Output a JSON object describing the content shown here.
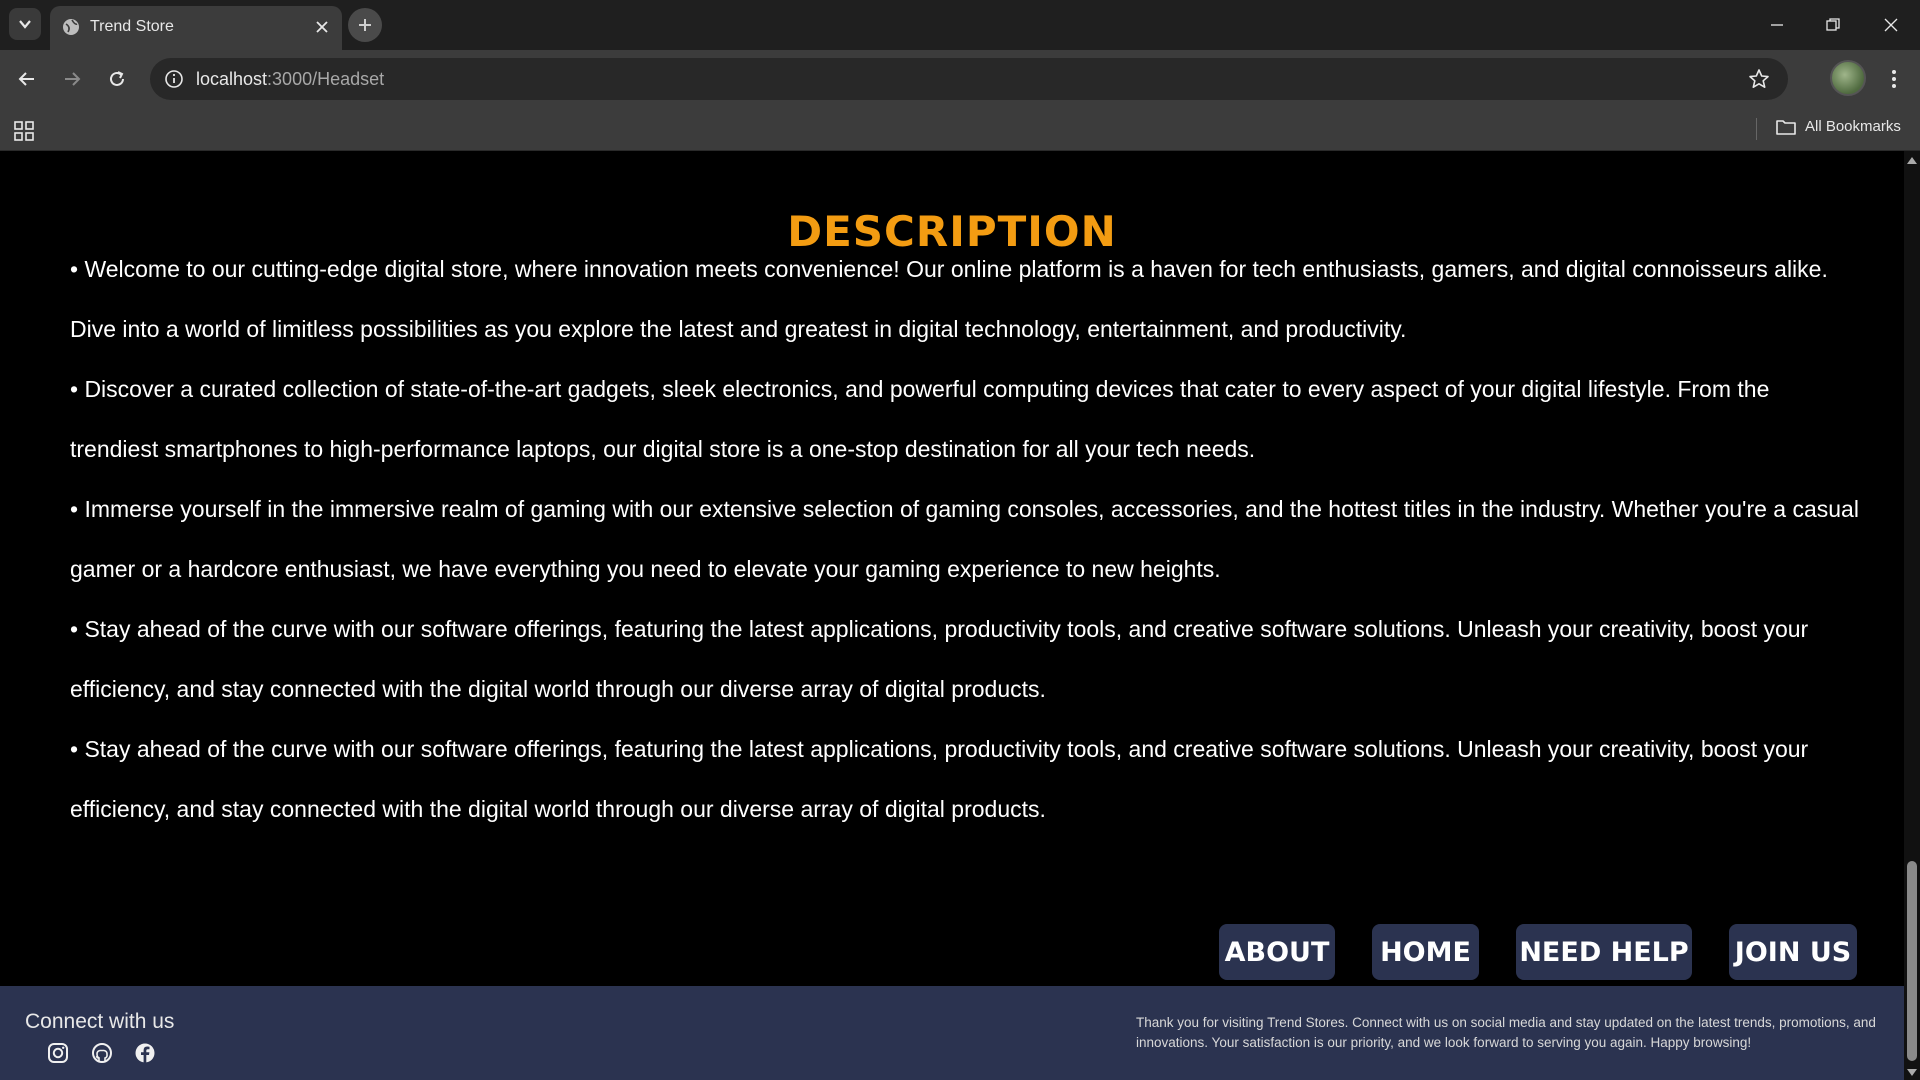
{
  "browser": {
    "tab_title": "Trend Store",
    "url_host": "localhost",
    "url_path": ":3000/Headset",
    "bookmarks_label": "All Bookmarks"
  },
  "page": {
    "title": "DESCRIPTION",
    "paragraphs": [
      "• Welcome to our cutting-edge digital store, where innovation meets convenience! Our online platform is a haven for tech enthusiasts, gamers, and digital connoisseurs alike. Dive into a world of limitless possibilities as you explore the latest and greatest in digital technology, entertainment, and productivity.",
      "• Discover a curated collection of state-of-the-art gadgets, sleek electronics, and powerful computing devices that cater to every aspect of your digital lifestyle. From the trendiest smartphones to high-performance laptops, our digital store is a one-stop destination for all your tech needs.",
      "• Immerse yourself in the immersive realm of gaming with our extensive selection of gaming consoles, accessories, and the hottest titles in the industry. Whether you're a casual gamer or a hardcore enthusiast, we have everything you need to elevate your gaming experience to new heights.",
      "• Stay ahead of the curve with our software offerings, featuring the latest applications, productivity tools, and creative software solutions. Unleash your creativity, boost your efficiency, and stay connected with the digital world through our diverse array of digital products.",
      "• Stay ahead of the curve with our software offerings, featuring the latest applications, productivity tools, and creative software solutions. Unleash your creativity, boost your efficiency, and stay connected with the digital world through our diverse array of digital products."
    ],
    "nav": {
      "about": "ABOUT",
      "home": "HOME",
      "need_help": "NEED HELP",
      "join_us": "JOIN US"
    }
  },
  "footer": {
    "connect_label": "Connect with us",
    "social_icons": [
      "instagram-icon",
      "github-icon",
      "facebook-icon"
    ],
    "thanks_text": "Thank you for visiting Trend Stores. Connect with us on social media and stay updated on the latest trends, promotions, and innovations. Your satisfaction is our priority, and we look forward to serving you again. Happy browsing!"
  },
  "colors": {
    "title_accent": "#f39c12",
    "footer_bg": "#2b3350",
    "page_bg": "#000000"
  }
}
